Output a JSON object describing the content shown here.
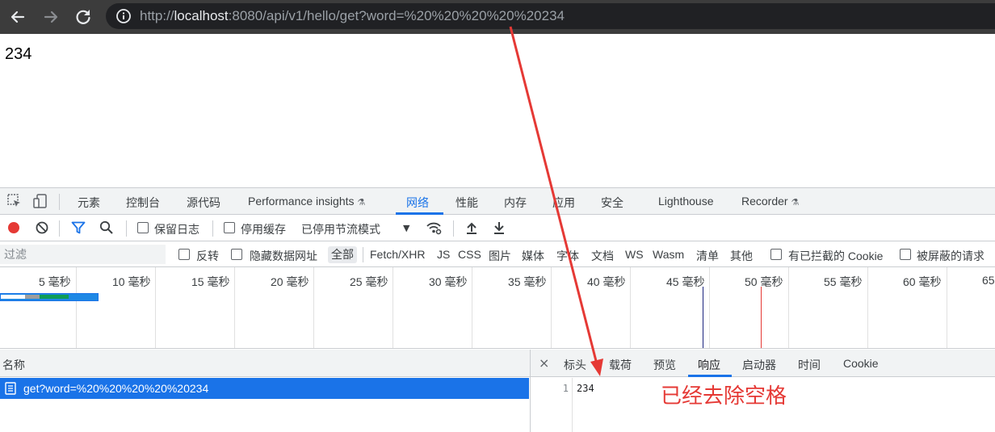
{
  "browser": {
    "url_scheme": "http://",
    "url_host": "localhost",
    "url_rest": ":8080/api/v1/hello/get?word=%20%20%20%20%20234"
  },
  "page": {
    "text": "234"
  },
  "devtools": {
    "tabs": [
      {
        "label": "元素"
      },
      {
        "label": "控制台"
      },
      {
        "label": "源代码"
      },
      {
        "label": "Performance insights",
        "flask": "⚗"
      },
      {
        "label": "网络"
      },
      {
        "label": "性能"
      },
      {
        "label": "内存"
      },
      {
        "label": "应用"
      },
      {
        "label": "安全"
      },
      {
        "label": "Lighthouse"
      },
      {
        "label": "Recorder",
        "flask": "⚗"
      }
    ],
    "active_tab": "网络",
    "toolbar": {
      "preserve_log": "保留日志",
      "disable_cache": "停用缓存",
      "throttling": "已停用节流模式"
    },
    "filter": {
      "placeholder": "过滤",
      "invert": "反转",
      "hide_data_urls": "隐藏数据网址",
      "types": [
        "全部",
        "Fetch/XHR",
        "JS",
        "CSS",
        "图片",
        "媒体",
        "字体",
        "文档",
        "WS",
        "Wasm",
        "清单",
        "其他"
      ],
      "blocked_cookies": "有已拦截的 Cookie",
      "blocked_requests": "被屏蔽的请求"
    },
    "timeline": {
      "ticks": [
        "5 毫秒",
        "10 毫秒",
        "15 毫秒",
        "20 毫秒",
        "25 毫秒",
        "30 毫秒",
        "35 毫秒",
        "40 毫秒",
        "45 毫秒",
        "50 毫秒",
        "55 毫秒",
        "60 毫秒",
        "65"
      ]
    },
    "requests": {
      "name_header": "名称",
      "items": [
        {
          "name": "get?word=%20%20%20%20%20234"
        }
      ]
    },
    "detail": {
      "close": "×",
      "tabs": [
        "标头",
        "载荷",
        "预览",
        "响应",
        "启动器",
        "时间",
        "Cookie"
      ],
      "active": "响应",
      "response_line_no": "1",
      "response_text": "234"
    }
  },
  "annotation": {
    "text": "已经去除空格",
    "color": "#e53935"
  },
  "colors": {
    "accent": "#1a73e8",
    "record": "#e53935"
  }
}
